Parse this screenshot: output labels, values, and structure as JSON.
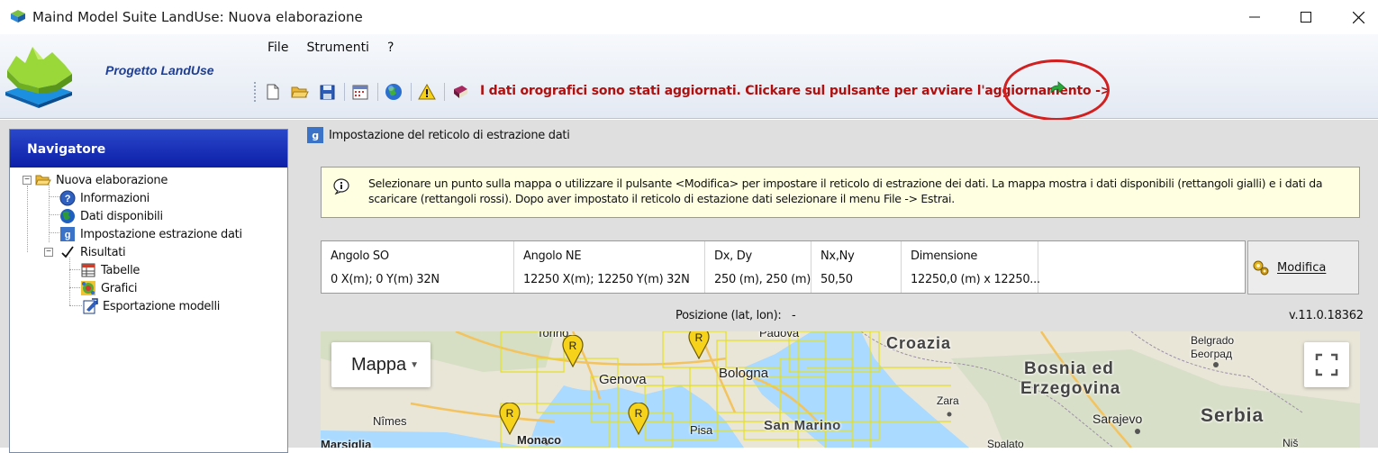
{
  "window": {
    "title": "Maind Model Suite LandUse: Nuova elaborazione",
    "controls": {
      "minimize": "—",
      "maximize": "☐",
      "close": "✕"
    }
  },
  "header": {
    "project_title": "Progetto LandUse",
    "menu": [
      "File",
      "Strumenti",
      "?"
    ],
    "toolbar_icons": [
      "new-document-icon",
      "open-folder-icon",
      "save-icon",
      "calendar-icon",
      "globe-icon",
      "warning-icon",
      "book-icon"
    ],
    "alert": "I dati orografici sono stati aggiornati. Clickare sul pulsante per avviare l'aggiornamento ->",
    "colors": {
      "alert": "#b01010",
      "highlight_ring": "#d21f1f",
      "nav_header": "#0c1fa8"
    }
  },
  "navigator": {
    "title": "Navigatore",
    "tree": {
      "root": {
        "label": "Nuova elaborazione",
        "expander": "−"
      },
      "items": [
        {
          "label": "Informazioni",
          "icon": "help-icon"
        },
        {
          "label": "Dati disponibili",
          "icon": "globe-icon"
        },
        {
          "label": "Impostazione estrazione dati",
          "icon": "grid-settings-icon"
        }
      ],
      "results": {
        "label": "Risultati",
        "expander": "−",
        "children": [
          {
            "label": "Tabelle",
            "icon": "table-icon"
          },
          {
            "label": "Grafici",
            "icon": "chart-icon"
          },
          {
            "label": "Esportazione modelli",
            "icon": "export-icon"
          }
        ]
      }
    }
  },
  "main": {
    "section_title": "Impostazione del reticolo di estrazione  dati",
    "info": "Selezionare un punto sulla mappa o utilizzare il pulsante <Modifica> per impostare il reticolo di estrazione dei dati. La mappa mostra i dati disponibili (rettangoli gialli) e i dati da scaricare (rettangoli rossi). Dopo aver impostato il reticolo di estazione dati selezionare il menu File -> Estrai.",
    "grid": {
      "columns": [
        {
          "header": "Angolo SO",
          "value": "0 X(m); 0 Y(m) 32N"
        },
        {
          "header": "Angolo NE",
          "value": "12250 X(m); 12250 Y(m) 32N"
        },
        {
          "header": "Dx, Dy",
          "value": "250 (m), 250 (m)"
        },
        {
          "header": "Nx,Ny",
          "value": "50,50"
        },
        {
          "header": "Dimensione",
          "value": "12250,0 (m) x 12250..."
        }
      ]
    },
    "modifica_label": "Modifica",
    "position_label": "Posizione (lat, lon):",
    "position_value": "-",
    "version": "v.11.0.18362"
  },
  "map": {
    "type_label": "Mappa",
    "labels": {
      "torino": "Torino",
      "padova": "Padova",
      "genova": "Genova",
      "bologna": "Bologna",
      "croazia": "Croazia",
      "bosnia": "Bosnia ed",
      "erzegovina": "Erzegovina",
      "beograd": "Belgrado",
      "beograd_cyr": "Београд",
      "zara": "Zara",
      "sarajevo": "Sarajevo",
      "serbia": "Serbia",
      "pisa": "Pisa",
      "san_marino": "San Marino",
      "nimes": "Nîmes",
      "monaco": "Monaco",
      "nis": "Niš",
      "marsiglia": "Marsiglia",
      "spalato": "Spalato"
    },
    "marker_letter": "R",
    "colors": {
      "land": "#e9e6d8",
      "sea": "#aadaff",
      "grid": "#e8e82a",
      "roads": "#f4c96a"
    }
  }
}
